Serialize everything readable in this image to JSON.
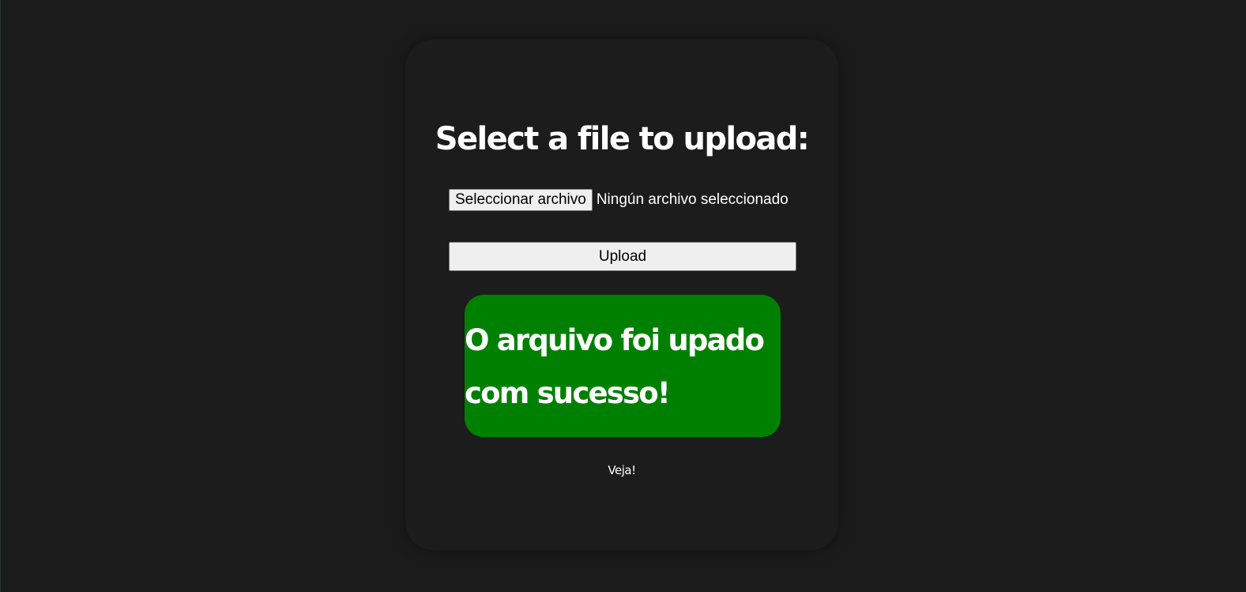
{
  "form": {
    "title": "Select a file to upload:",
    "file_button_label": "Seleccionar archivo",
    "file_status": "Ningún archivo seleccionado",
    "upload_label": "Upload"
  },
  "message": {
    "text": "O arquivo foi upado com sucesso!",
    "color": "#008000"
  },
  "link": {
    "label": "Veja!"
  }
}
